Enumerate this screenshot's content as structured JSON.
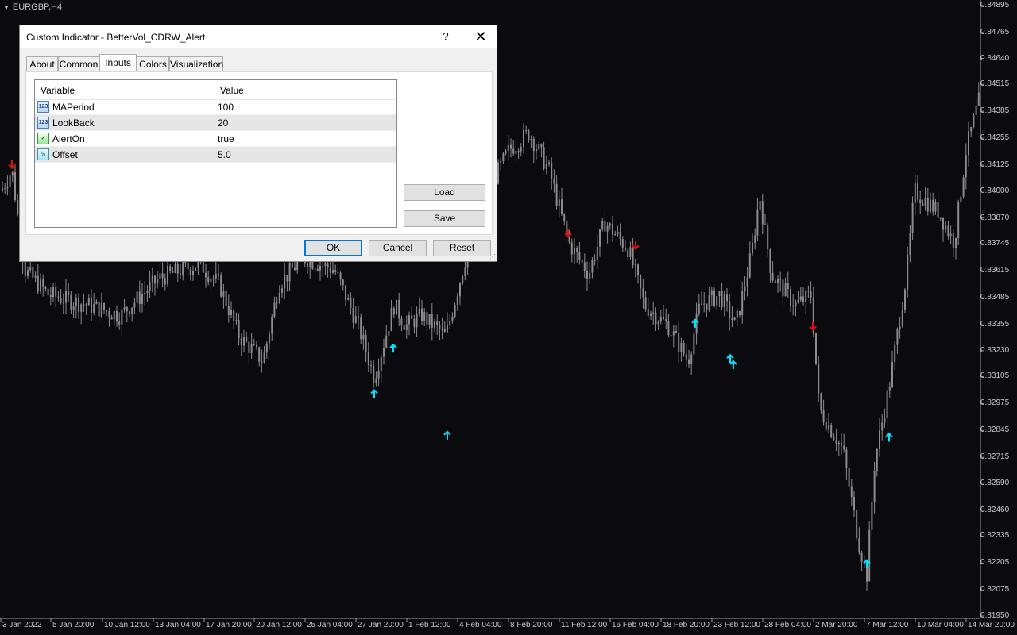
{
  "chart": {
    "symbol": "EURGBP,H4",
    "price_ticks": [
      "0.84895",
      "0.84765",
      "0.84640",
      "0.84515",
      "0.84385",
      "0.84255",
      "0.84125",
      "0.84000",
      "0.83870",
      "0.83745",
      "0.83615",
      "0.83485",
      "0.83355",
      "0.83230",
      "0.83105",
      "0.82975",
      "0.82845",
      "0.82715",
      "0.82590",
      "0.82460",
      "0.82335",
      "0.82205",
      "0.82075",
      "0.81950"
    ],
    "time_ticks": [
      "3 Jan 2022",
      "5 Jan 20:00",
      "10 Jan 12:00",
      "13 Jan 04:00",
      "17 Jan 20:00",
      "20 Jan 12:00",
      "25 Jan 04:00",
      "27 Jan 20:00",
      "1 Feb 12:00",
      "4 Feb 04:00",
      "8 Feb 20:00",
      "11 Feb 12:00",
      "16 Feb 04:00",
      "18 Feb 20:00",
      "23 Feb 12:00",
      "28 Feb 04:00",
      "2 Mar 20:00",
      "7 Mar 12:00",
      "10 Mar 04:00",
      "14 Mar 20:00"
    ],
    "colors": {
      "background": "#0b0b0f",
      "candle": "#8c8c8c",
      "up_arrow": "#00e5ff",
      "down_arrow": "#e01010"
    },
    "sell_signals": [
      {
        "time": "3 Jan 2022",
        "price": 0.8413
      },
      {
        "time": "11 Feb 12:00",
        "price": 0.838
      },
      {
        "time": "16 Feb 04:00",
        "price": 0.8374
      },
      {
        "time": "1 Mar",
        "price": 0.8335
      }
    ],
    "buy_signals": [
      {
        "time": "27 Jan 20:00",
        "price": 0.8302
      },
      {
        "time": "28 Jan",
        "price": 0.8324
      },
      {
        "time": "1 Feb 12:00",
        "price": 0.8282
      },
      {
        "time": "18 Feb 20:00",
        "price": 0.8336
      },
      {
        "time": "21 Feb",
        "price": 0.8319
      },
      {
        "time": "21 Feb 04:00",
        "price": 0.8316
      },
      {
        "time": "7 Mar 12:00",
        "price": 0.8281
      },
      {
        "time": "4 Mar",
        "price": 0.822
      }
    ]
  },
  "dialog": {
    "title": "Custom Indicator - BetterVol_CDRW_Alert",
    "help_glyph": "?",
    "close_glyph": "✕",
    "tabs": [
      {
        "label": "About"
      },
      {
        "label": "Common"
      },
      {
        "label": "Inputs",
        "active": true
      },
      {
        "label": "Colors"
      },
      {
        "label": "Visualization"
      }
    ],
    "grid": {
      "col_variable": "Variable",
      "col_value": "Value",
      "rows": [
        {
          "icon": "int-icon",
          "icon_text": "123",
          "name": "MAPeriod",
          "value": "100"
        },
        {
          "icon": "int-icon",
          "icon_text": "123",
          "name": "LookBack",
          "value": "20"
        },
        {
          "icon": "bool-icon",
          "icon_text": "✓",
          "name": "AlertOn",
          "value": "true"
        },
        {
          "icon": "double-icon",
          "icon_text": "½",
          "name": "Offset",
          "value": "5.0"
        }
      ]
    },
    "load_label": "Load",
    "save_label": "Save",
    "ok_label": "OK",
    "cancel_label": "Cancel",
    "reset_label": "Reset"
  }
}
